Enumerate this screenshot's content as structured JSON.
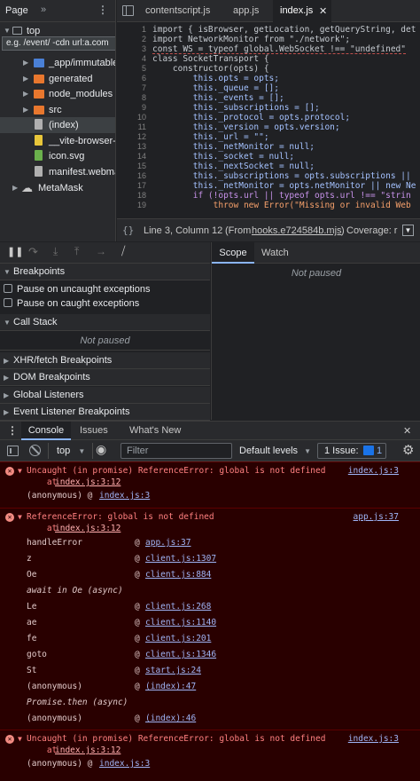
{
  "left_pane": {
    "tab_label": "Page",
    "top_frame": "top",
    "tooltip": "e.g. /event/ -cdn url:a.com",
    "tree_items": [
      {
        "label": "_app/immutable",
        "kind": "folder"
      },
      {
        "label": "generated",
        "kind": "folder"
      },
      {
        "label": "node_modules",
        "kind": "folder"
      },
      {
        "label": "src",
        "kind": "folder"
      },
      {
        "label": "(index)",
        "kind": "file"
      },
      {
        "label": "__vite-browser-e",
        "kind": "file"
      },
      {
        "label": "icon.svg",
        "kind": "file"
      },
      {
        "label": "manifest.webma",
        "kind": "file"
      },
      {
        "label": "MetaMask",
        "kind": "cloud"
      }
    ]
  },
  "editor": {
    "tabs": [
      "contentscript.js",
      "app.js",
      "index.js"
    ],
    "active_tab": "index.js",
    "line_numbers": [
      "1",
      "2",
      "3",
      "4",
      "5",
      "6",
      "7",
      "8",
      "9",
      "10",
      "11",
      "12",
      "13",
      "14",
      "15",
      "16",
      "17",
      "18",
      "19"
    ],
    "lines": [
      "import { isBrowser, getLocation, getQueryString, det",
      "import NetworkMonitor from \"./network\";",
      "const WS = typeof global.WebSocket !== \"undefined\"",
      "class SocketTransport {",
      "    constructor(opts) {",
      "        this.opts = opts;",
      "        this._queue = [];",
      "        this._events = [];",
      "        this._subscriptions = [];",
      "        this._protocol = opts.protocol;",
      "        this._version = opts.version;",
      "        this._url = \"\";",
      "        this._netMonitor = null;",
      "        this._socket = null;",
      "        this._nextSocket = null;",
      "        this._subscriptions = opts.subscriptions ||",
      "        this._netMonitor = opts.netMonitor || new Ne",
      "        if (!opts.url || typeof opts.url !== \"strin",
      "            throw new Error(\"Missing or invalid Web"
    ],
    "status_position": "Line 3, Column 12",
    "status_from_prefix": "(From",
    "status_from_file": "hooks.e724584b.mjs",
    "status_from_suffix": ")",
    "status_coverage": "Coverage: r"
  },
  "debugger": {
    "sections": [
      "Breakpoints",
      "Call Stack",
      "XHR/fetch Breakpoints",
      "DOM Breakpoints",
      "Global Listeners",
      "Event Listener Breakpoints"
    ],
    "pause_uncaught": "Pause on uncaught exceptions",
    "pause_caught": "Pause on caught exceptions",
    "call_stack_status": "Not paused",
    "scope_tab": "Scope",
    "watch_tab": "Watch",
    "scope_status": "Not paused"
  },
  "drawer": {
    "tabs": [
      "Console",
      "Issues",
      "What's New"
    ],
    "context": "top",
    "filter_placeholder": "Filter",
    "levels": "Default levels",
    "issues_label": "1 Issue:",
    "issues_count": "1"
  },
  "console": {
    "msg1": {
      "text": "Uncaught (in promise) ReferenceError: global is not defined",
      "source": "index.js:3",
      "at_prefix": "    at ",
      "at_link": "index.js:3:12",
      "anon_prefix": "(anonymous) @ ",
      "anon_link": "index.js:3"
    },
    "msg2": {
      "text": "ReferenceError: global is not defined",
      "source": "app.js:37",
      "at_prefix": "    at ",
      "at_link": "index.js:3:12",
      "frames": [
        {
          "fn": "handleError",
          "loc": "app.js:37"
        },
        {
          "fn": "z",
          "loc": "client.js:1307"
        },
        {
          "fn": "Oe",
          "loc": "client.js:884"
        },
        {
          "fn": "await in Oe (async)",
          "loc": ""
        },
        {
          "fn": "Le",
          "loc": "client.js:268"
        },
        {
          "fn": "ae",
          "loc": "client.js:1140"
        },
        {
          "fn": "fe",
          "loc": "client.js:201"
        },
        {
          "fn": "goto",
          "loc": "client.js:1346"
        },
        {
          "fn": "St",
          "loc": "start.js:24"
        },
        {
          "fn": "(anonymous)",
          "loc": "(index):47"
        },
        {
          "fn": "Promise.then (async)",
          "loc": ""
        },
        {
          "fn": "(anonymous)",
          "loc": "(index):46"
        }
      ]
    },
    "msg3": {
      "text": "Uncaught (in promise) ReferenceError: global is not defined",
      "source": "index.js:3",
      "at_prefix": "    at ",
      "at_link": "index.js:3:12",
      "anon_prefix": "(anonymous) @ ",
      "anon_link": "index.js:3"
    }
  },
  "colors": {
    "folder": "#e8772e",
    "folder_blue": "#4a80d6",
    "file_js": "#e8c63a",
    "file_svg": "#6ab04c",
    "error_bg": "#290000",
    "error_text": "#ff8080",
    "link": "#9fb4f5",
    "accent": "#8ab4f8"
  }
}
